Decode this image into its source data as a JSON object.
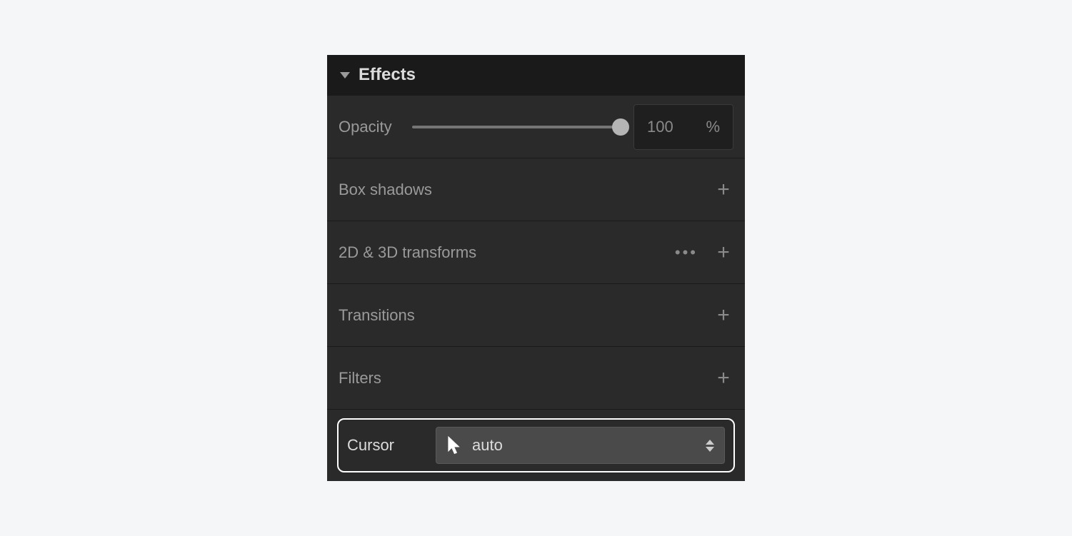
{
  "panel": {
    "title": "Effects"
  },
  "opacity": {
    "label": "Opacity",
    "value": "100",
    "unit": "%"
  },
  "rows": {
    "box_shadows": "Box shadows",
    "transforms": "2D & 3D transforms",
    "transitions": "Transitions",
    "filters": "Filters"
  },
  "cursor": {
    "label": "Cursor",
    "value": "auto"
  }
}
